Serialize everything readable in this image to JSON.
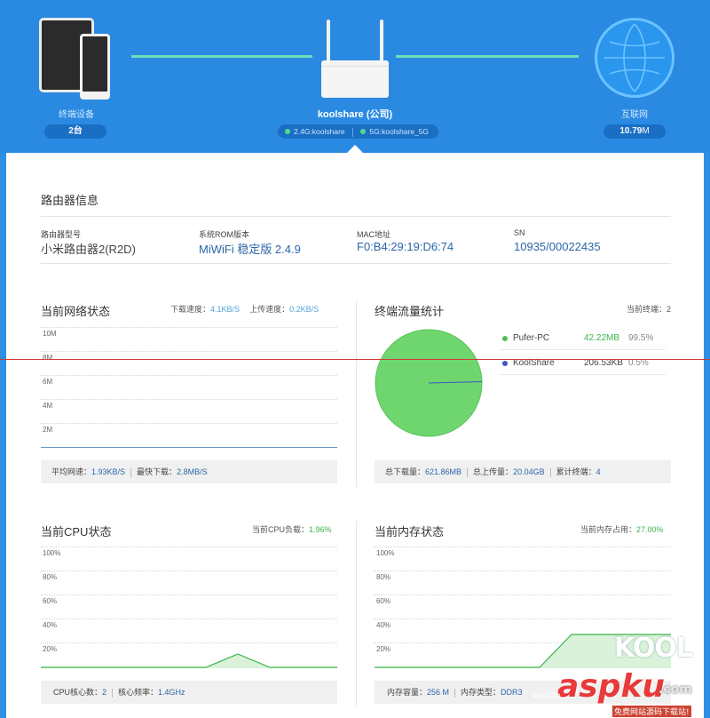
{
  "topology": {
    "devices": {
      "label": "终端设备",
      "count": "2台"
    },
    "router": {
      "name": "koolshare (公司)",
      "ssid_24": "2.4G:koolshare",
      "ssid_5": "5G:koolshare_5G"
    },
    "internet": {
      "label": "互联网",
      "speed": "10.79",
      "speed_unit": "M"
    }
  },
  "router_info": {
    "title": "路由器信息",
    "fields": [
      {
        "label": "路由器型号",
        "value": "小米路由器2(R2D)"
      },
      {
        "label": "系统ROM版本",
        "value": "MiWiFi 稳定版 2.4.9"
      },
      {
        "label": "MAC地址",
        "value": "F0:B4:29:19:D6:74"
      },
      {
        "label": "SN",
        "value": "10935/00022435"
      }
    ]
  },
  "network": {
    "title": "当前网络状态",
    "download_label": "下载速度：",
    "download_value": "4.1KB/S",
    "upload_label": "上传速度：",
    "upload_value": "0.2KB/S",
    "y_ticks": [
      "10M",
      "8M",
      "6M",
      "4M",
      "2M"
    ],
    "avg_label": "平均网速：",
    "avg_value": "1.93KB/S",
    "max_label": "最快下载：",
    "max_value": "2.8MB/S"
  },
  "traffic": {
    "title": "终端流量统计",
    "count_label": "当前终端：",
    "count_value": "2",
    "legend": [
      {
        "name": "Pufer-PC",
        "size": "42.22MB",
        "pct": "99.5%",
        "color": "#4fc04f"
      },
      {
        "name": "KoolShare",
        "size": "206.53KB",
        "pct": "0.5%",
        "color": "#3b55c8"
      }
    ],
    "total_down_label": "总下载量：",
    "total_down": "621.86MB",
    "total_up_label": "总上传量：",
    "total_up": "20.04GB",
    "cumulative_label": "累计终端：",
    "cumulative": "4"
  },
  "cpu": {
    "title": "当前CPU状态",
    "load_label": "当前CPU负载：",
    "load_value": "1.96%",
    "y_ticks": [
      "100%",
      "80%",
      "60%",
      "40%",
      "20%"
    ],
    "cores_label": "CPU核心数：",
    "cores_value": "2",
    "freq_label": "核心频率：",
    "freq_value": "1.4GHz"
  },
  "memory": {
    "title": "当前内存状态",
    "usage_label": "当前内存占用：",
    "usage_value": "27.00%",
    "y_ticks": [
      "100%",
      "80%",
      "60%",
      "40%",
      "20%"
    ],
    "capacity_label": "内存容量：",
    "capacity_value": "256 M",
    "type_label": "内存类型：",
    "type_value": "DDR3"
  },
  "watermark": {
    "brand": "KOOL",
    "site": "aspku",
    "tld": ".com",
    "caption": "免费网站源码下载站!",
    "small": "koolsh..."
  },
  "colors": {
    "banner": "#2a8ae2",
    "accent": "#2b66a8",
    "green": "#3cb44a",
    "pie": "#6fd66f"
  }
}
